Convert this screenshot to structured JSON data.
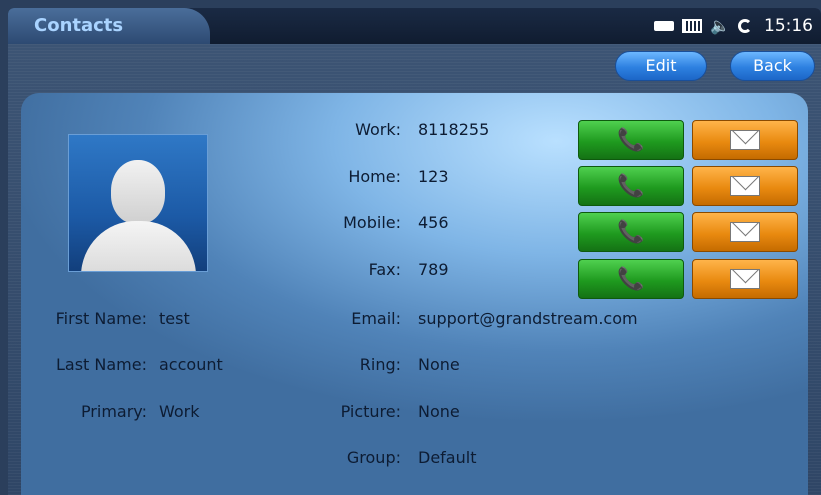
{
  "header": {
    "title": "Contacts",
    "time": "15:16"
  },
  "status_icons": [
    "battery-icon",
    "keyboard-icon",
    "speaker-icon",
    "sync-icon"
  ],
  "toolbar": {
    "edit_label": "Edit",
    "back_label": "Back"
  },
  "contact": {
    "first_name_label": "First Name:",
    "first_name": "test",
    "last_name_label": "Last Name:",
    "last_name": "account",
    "primary_label": "Primary:",
    "primary": "Work",
    "work_label": "Work:",
    "work": "8118255",
    "home_label": "Home:",
    "home": "123",
    "mobile_label": "Mobile:",
    "mobile": "456",
    "fax_label": "Fax:",
    "fax": "789",
    "email_label": "Email:",
    "email": "support@grandstream.com",
    "ring_label": "Ring:",
    "ring": "None",
    "picture_label": "Picture:",
    "picture": "None",
    "group_label": "Group:",
    "group": "Default"
  },
  "colors": {
    "call": "#1f9a1f",
    "message": "#e98a10",
    "accent": "#2d80e0"
  },
  "icons": {
    "call": "phone-icon",
    "message": "envelope-icon"
  }
}
